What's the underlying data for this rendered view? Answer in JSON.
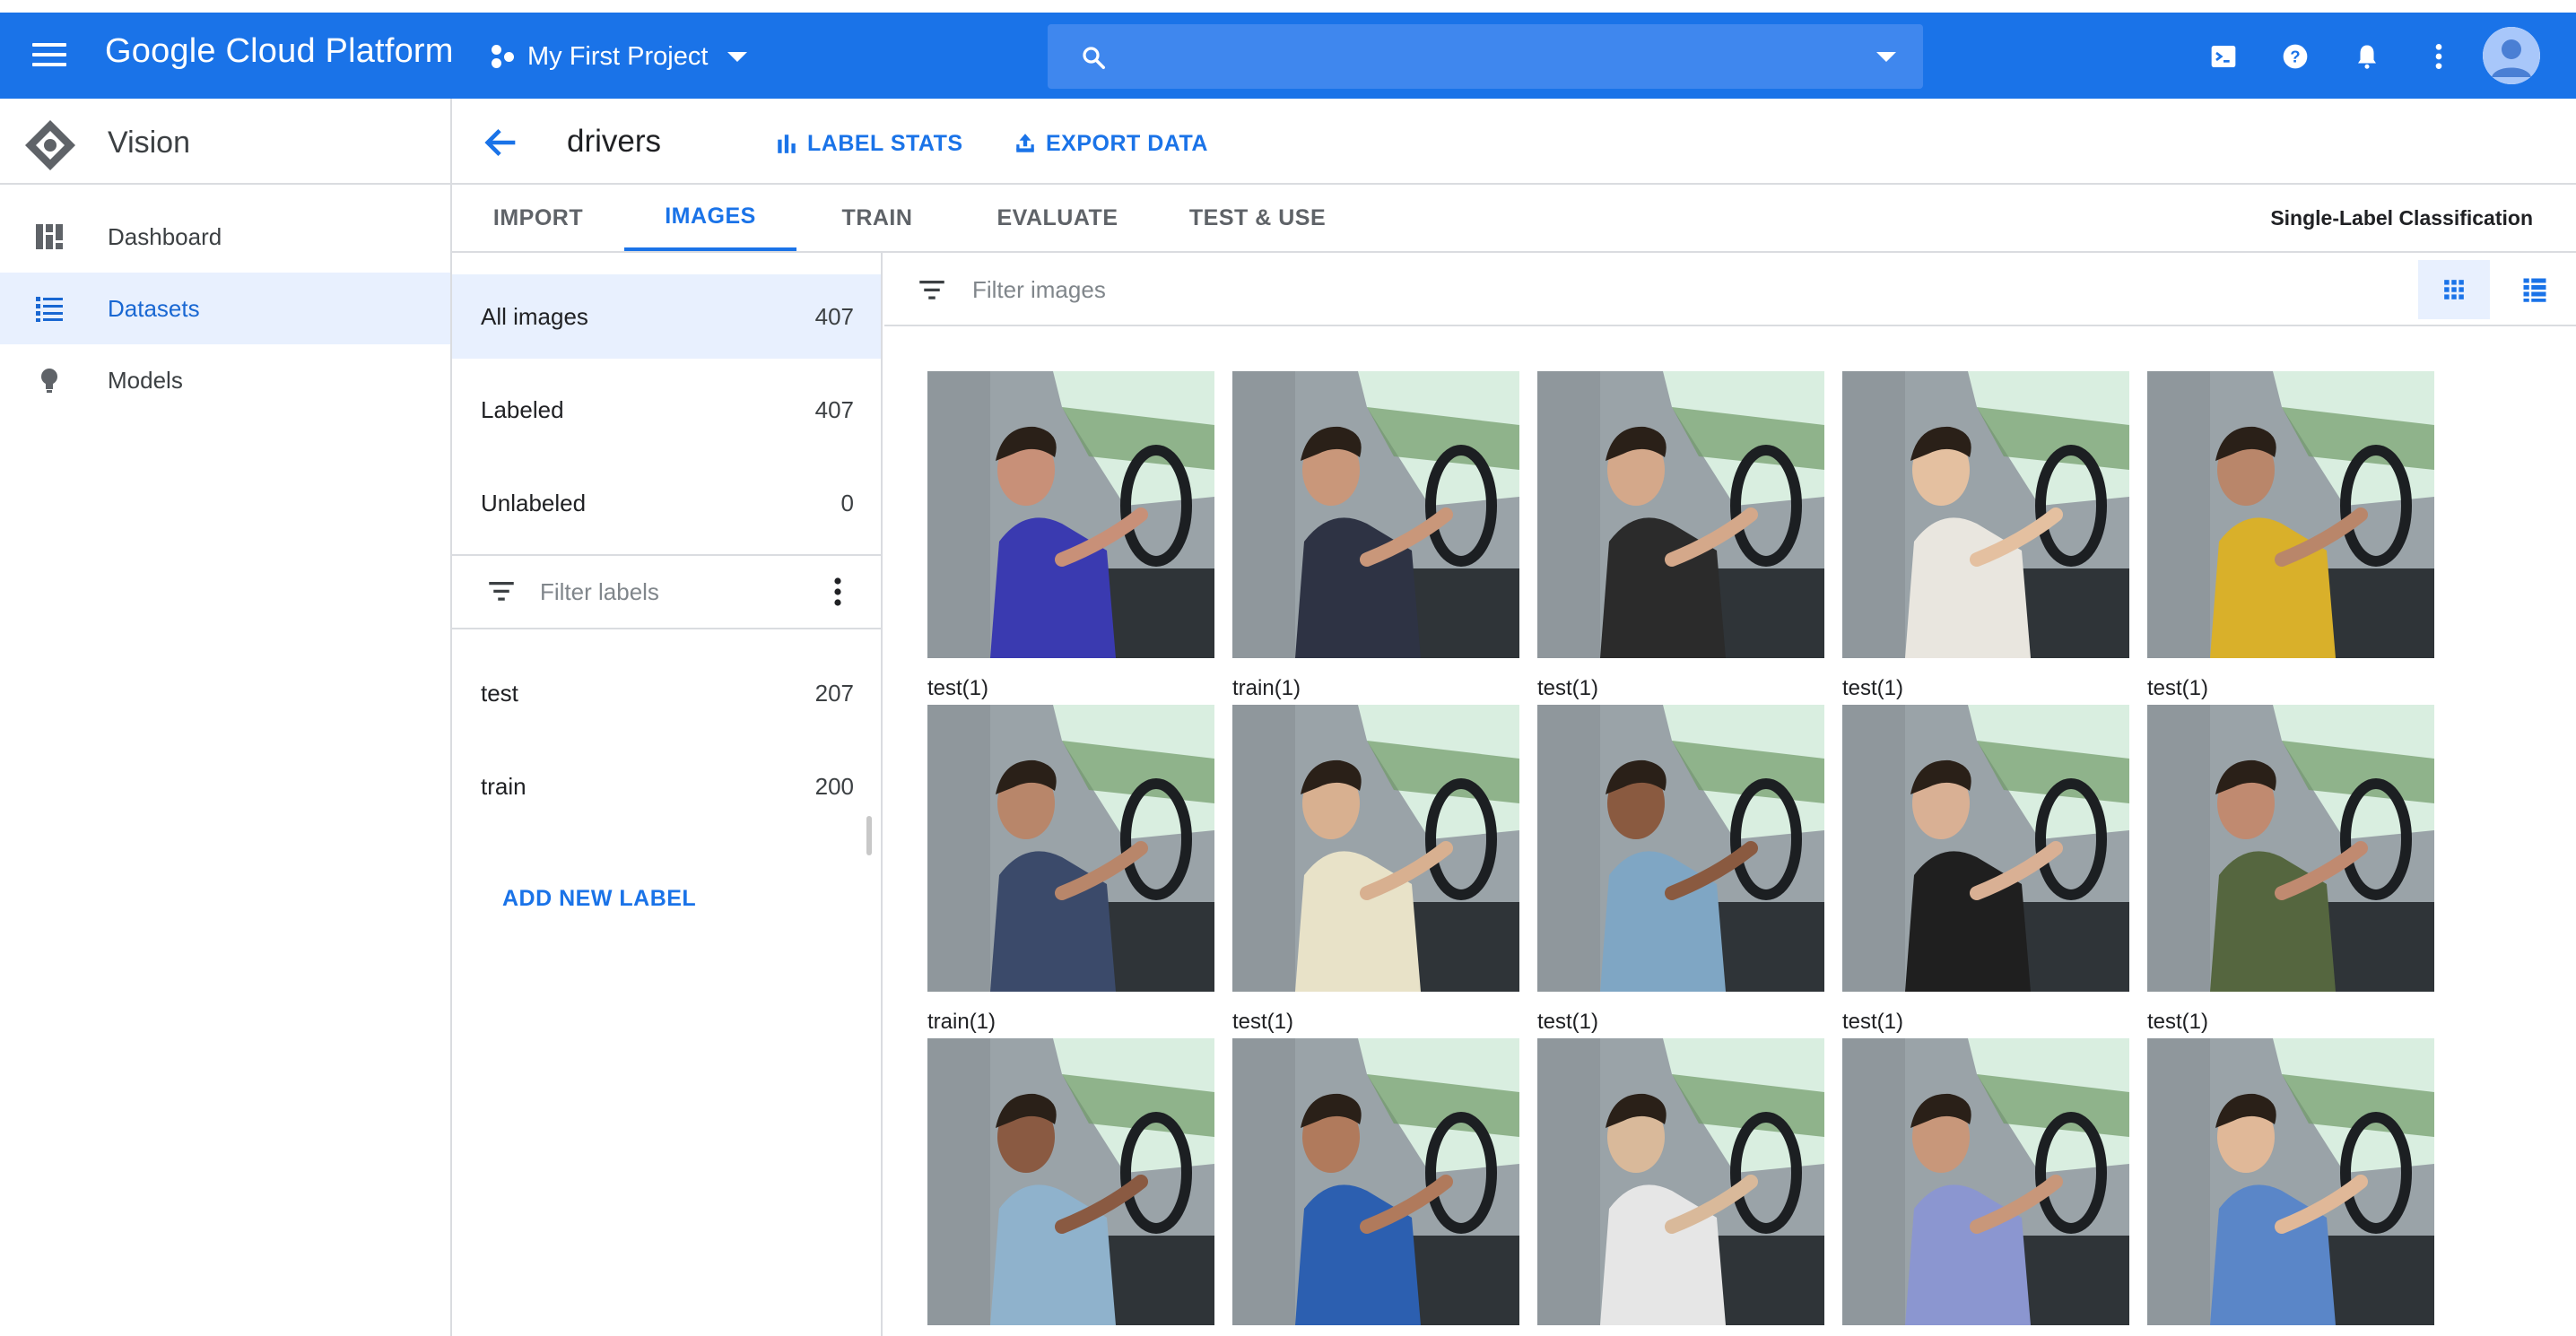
{
  "appbar": {
    "brand": "Google Cloud Platform",
    "project": "My First Project",
    "search_placeholder": "",
    "accent": "#1a73e8"
  },
  "leftnav": {
    "product": "Vision",
    "items": [
      {
        "label": "Dashboard",
        "icon": "dashboard-icon"
      },
      {
        "label": "Datasets",
        "icon": "list-icon",
        "active": true
      },
      {
        "label": "Models",
        "icon": "lightbulb-icon"
      }
    ]
  },
  "header": {
    "title": "drivers",
    "label_stats": "LABEL STATS",
    "export_data": "EXPORT DATA"
  },
  "tabs": {
    "items": [
      "IMPORT",
      "IMAGES",
      "TRAIN",
      "EVALUATE",
      "TEST & USE"
    ],
    "active": "IMAGES",
    "mode": "Single-Label Classification"
  },
  "filters": {
    "all_images": {
      "label": "All images",
      "count": "407"
    },
    "labeled": {
      "label": "Labeled",
      "count": "407"
    },
    "unlabeled": {
      "label": "Unlabeled",
      "count": "0"
    },
    "filter_labels_placeholder": "Filter labels",
    "labels": [
      {
        "label": "test",
        "count": "207"
      },
      {
        "label": "train",
        "count": "200"
      }
    ],
    "add_new_label": "ADD NEW LABEL"
  },
  "images": {
    "filter_placeholder": "Filter images",
    "captions_row1": [
      "test(1)",
      "train(1)",
      "test(1)",
      "test(1)",
      "test(1)"
    ],
    "captions_row2": [
      "train(1)",
      "test(1)",
      "test(1)",
      "test(1)",
      "test(1)"
    ]
  }
}
